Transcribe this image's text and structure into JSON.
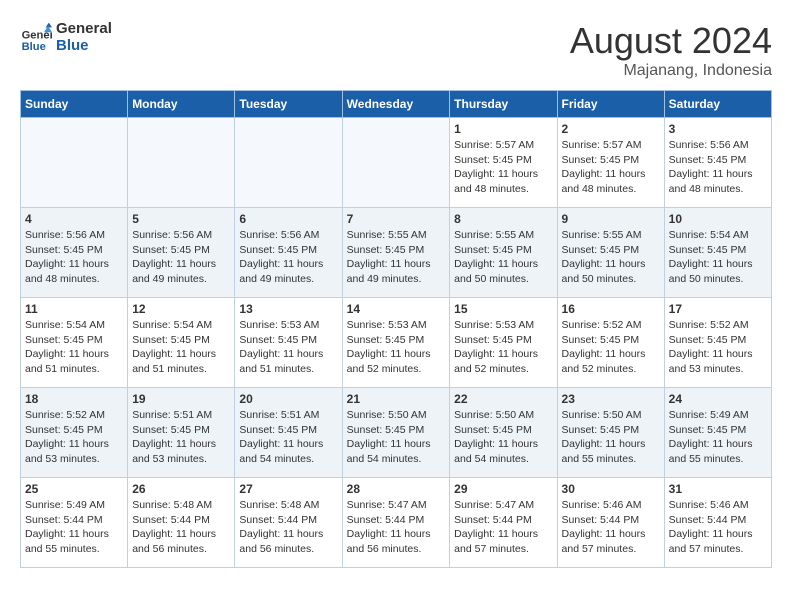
{
  "logo": {
    "general": "General",
    "blue": "Blue"
  },
  "title": {
    "month_year": "August 2024",
    "location": "Majanang, Indonesia"
  },
  "header": {
    "days": [
      "Sunday",
      "Monday",
      "Tuesday",
      "Wednesday",
      "Thursday",
      "Friday",
      "Saturday"
    ]
  },
  "weeks": [
    {
      "row_style": "normal",
      "days": [
        {
          "num": "",
          "info": ""
        },
        {
          "num": "",
          "info": ""
        },
        {
          "num": "",
          "info": ""
        },
        {
          "num": "",
          "info": ""
        },
        {
          "num": "1",
          "info": "Sunrise: 5:57 AM\nSunset: 5:45 PM\nDaylight: 11 hours\nand 48 minutes."
        },
        {
          "num": "2",
          "info": "Sunrise: 5:57 AM\nSunset: 5:45 PM\nDaylight: 11 hours\nand 48 minutes."
        },
        {
          "num": "3",
          "info": "Sunrise: 5:56 AM\nSunset: 5:45 PM\nDaylight: 11 hours\nand 48 minutes."
        }
      ]
    },
    {
      "row_style": "alt",
      "days": [
        {
          "num": "4",
          "info": "Sunrise: 5:56 AM\nSunset: 5:45 PM\nDaylight: 11 hours\nand 48 minutes."
        },
        {
          "num": "5",
          "info": "Sunrise: 5:56 AM\nSunset: 5:45 PM\nDaylight: 11 hours\nand 49 minutes."
        },
        {
          "num": "6",
          "info": "Sunrise: 5:56 AM\nSunset: 5:45 PM\nDaylight: 11 hours\nand 49 minutes."
        },
        {
          "num": "7",
          "info": "Sunrise: 5:55 AM\nSunset: 5:45 PM\nDaylight: 11 hours\nand 49 minutes."
        },
        {
          "num": "8",
          "info": "Sunrise: 5:55 AM\nSunset: 5:45 PM\nDaylight: 11 hours\nand 50 minutes."
        },
        {
          "num": "9",
          "info": "Sunrise: 5:55 AM\nSunset: 5:45 PM\nDaylight: 11 hours\nand 50 minutes."
        },
        {
          "num": "10",
          "info": "Sunrise: 5:54 AM\nSunset: 5:45 PM\nDaylight: 11 hours\nand 50 minutes."
        }
      ]
    },
    {
      "row_style": "normal",
      "days": [
        {
          "num": "11",
          "info": "Sunrise: 5:54 AM\nSunset: 5:45 PM\nDaylight: 11 hours\nand 51 minutes."
        },
        {
          "num": "12",
          "info": "Sunrise: 5:54 AM\nSunset: 5:45 PM\nDaylight: 11 hours\nand 51 minutes."
        },
        {
          "num": "13",
          "info": "Sunrise: 5:53 AM\nSunset: 5:45 PM\nDaylight: 11 hours\nand 51 minutes."
        },
        {
          "num": "14",
          "info": "Sunrise: 5:53 AM\nSunset: 5:45 PM\nDaylight: 11 hours\nand 52 minutes."
        },
        {
          "num": "15",
          "info": "Sunrise: 5:53 AM\nSunset: 5:45 PM\nDaylight: 11 hours\nand 52 minutes."
        },
        {
          "num": "16",
          "info": "Sunrise: 5:52 AM\nSunset: 5:45 PM\nDaylight: 11 hours\nand 52 minutes."
        },
        {
          "num": "17",
          "info": "Sunrise: 5:52 AM\nSunset: 5:45 PM\nDaylight: 11 hours\nand 53 minutes."
        }
      ]
    },
    {
      "row_style": "alt",
      "days": [
        {
          "num": "18",
          "info": "Sunrise: 5:52 AM\nSunset: 5:45 PM\nDaylight: 11 hours\nand 53 minutes."
        },
        {
          "num": "19",
          "info": "Sunrise: 5:51 AM\nSunset: 5:45 PM\nDaylight: 11 hours\nand 53 minutes."
        },
        {
          "num": "20",
          "info": "Sunrise: 5:51 AM\nSunset: 5:45 PM\nDaylight: 11 hours\nand 54 minutes."
        },
        {
          "num": "21",
          "info": "Sunrise: 5:50 AM\nSunset: 5:45 PM\nDaylight: 11 hours\nand 54 minutes."
        },
        {
          "num": "22",
          "info": "Sunrise: 5:50 AM\nSunset: 5:45 PM\nDaylight: 11 hours\nand 54 minutes."
        },
        {
          "num": "23",
          "info": "Sunrise: 5:50 AM\nSunset: 5:45 PM\nDaylight: 11 hours\nand 55 minutes."
        },
        {
          "num": "24",
          "info": "Sunrise: 5:49 AM\nSunset: 5:45 PM\nDaylight: 11 hours\nand 55 minutes."
        }
      ]
    },
    {
      "row_style": "normal",
      "days": [
        {
          "num": "25",
          "info": "Sunrise: 5:49 AM\nSunset: 5:44 PM\nDaylight: 11 hours\nand 55 minutes."
        },
        {
          "num": "26",
          "info": "Sunrise: 5:48 AM\nSunset: 5:44 PM\nDaylight: 11 hours\nand 56 minutes."
        },
        {
          "num": "27",
          "info": "Sunrise: 5:48 AM\nSunset: 5:44 PM\nDaylight: 11 hours\nand 56 minutes."
        },
        {
          "num": "28",
          "info": "Sunrise: 5:47 AM\nSunset: 5:44 PM\nDaylight: 11 hours\nand 56 minutes."
        },
        {
          "num": "29",
          "info": "Sunrise: 5:47 AM\nSunset: 5:44 PM\nDaylight: 11 hours\nand 57 minutes."
        },
        {
          "num": "30",
          "info": "Sunrise: 5:46 AM\nSunset: 5:44 PM\nDaylight: 11 hours\nand 57 minutes."
        },
        {
          "num": "31",
          "info": "Sunrise: 5:46 AM\nSunset: 5:44 PM\nDaylight: 11 hours\nand 57 minutes."
        }
      ]
    }
  ]
}
